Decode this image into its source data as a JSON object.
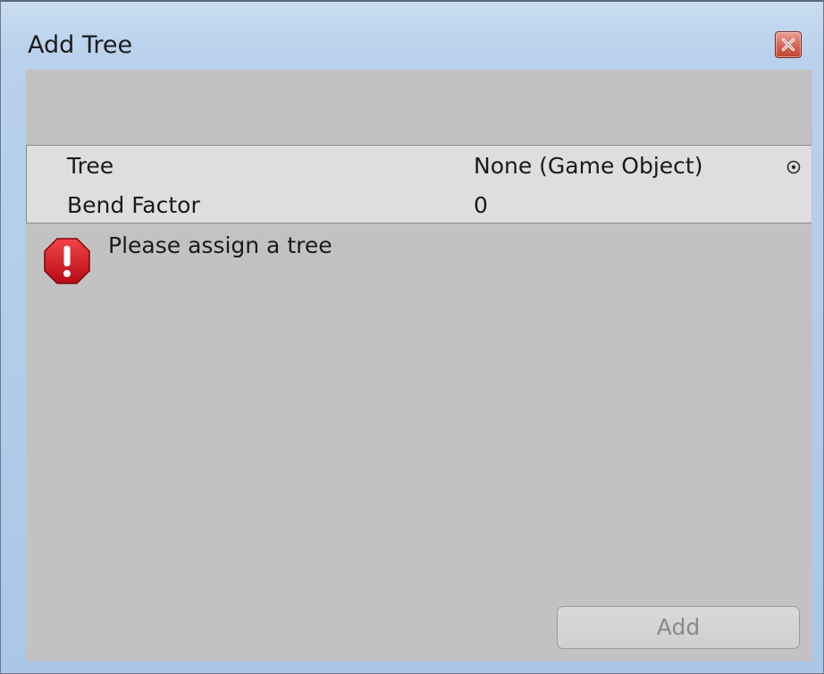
{
  "window": {
    "title": "Add Tree",
    "close_icon": "close-icon"
  },
  "inspector": {
    "rows": [
      {
        "label": "Tree",
        "value": "None (Game Object)",
        "picker_icon": "object-picker-icon"
      },
      {
        "label": "Bend Factor",
        "value": "0"
      }
    ]
  },
  "help_box": {
    "icon": "error-icon",
    "message": "Please assign a tree"
  },
  "footer": {
    "add_label": "Add",
    "add_enabled": false
  },
  "colors": {
    "title_bar": "#b9d1ec",
    "client_bg": "#c2c2c2",
    "inspector_bg": "#dedede",
    "error_red": "#d0121b",
    "disabled_text": "#8a8a8a"
  }
}
